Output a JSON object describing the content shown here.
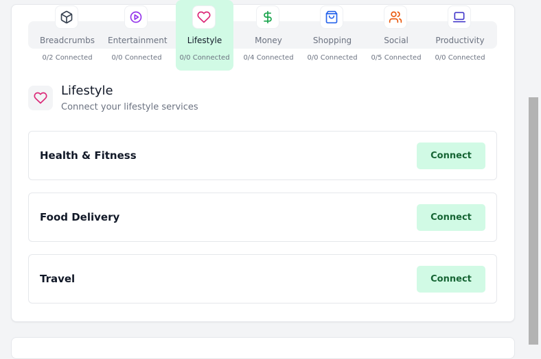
{
  "tabs": [
    {
      "label": "Breadcrumbs",
      "status": "0/2 Connected",
      "icon": "box-icon",
      "color": "#374151"
    },
    {
      "label": "Entertainment",
      "status": "0/0 Connected",
      "icon": "play-circle-icon",
      "color": "#9333ea"
    },
    {
      "label": "Lifestyle",
      "status": "0/0 Connected",
      "icon": "heart-icon",
      "color": "#db2777",
      "active": true
    },
    {
      "label": "Money",
      "status": "0/4 Connected",
      "icon": "dollar-icon",
      "color": "#16a34a"
    },
    {
      "label": "Shopping",
      "status": "0/0 Connected",
      "icon": "shopping-bag-icon",
      "color": "#2563eb"
    },
    {
      "label": "Social",
      "status": "0/5 Connected",
      "icon": "users-icon",
      "color": "#ea580c"
    },
    {
      "label": "Productivity",
      "status": "0/0 Connected",
      "icon": "laptop-icon",
      "color": "#4338ca"
    }
  ],
  "section": {
    "title": "Lifestyle",
    "subtitle": "Connect your lifestyle services",
    "icon": "heart-icon"
  },
  "services": [
    {
      "name": "Health & Fitness",
      "button": "Connect"
    },
    {
      "name": "Food Delivery",
      "button": "Connect"
    },
    {
      "name": "Travel",
      "button": "Connect"
    }
  ],
  "colors": {
    "accent_bg": "#d1fae5",
    "accent_text": "#166534"
  }
}
